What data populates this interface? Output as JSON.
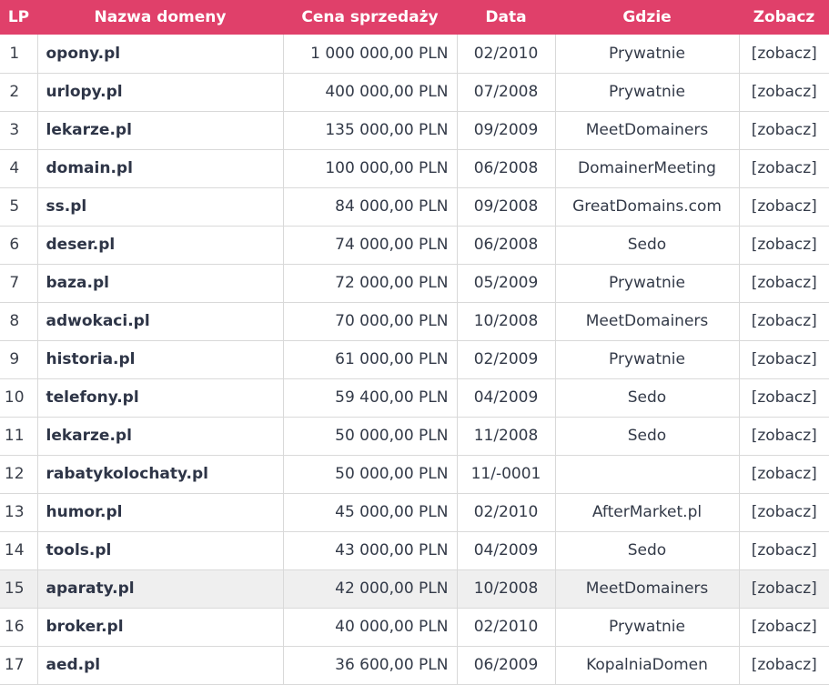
{
  "table": {
    "headers": {
      "lp": "LP",
      "name": "Nazwa domeny",
      "price": "Cena sprzedaży",
      "date": "Data",
      "where": "Gdzie",
      "view": "Zobacz"
    },
    "highlighted_row": 15,
    "rows": [
      {
        "lp": "1",
        "name": "opony.pl",
        "price": "1 000 000,00 PLN",
        "date": "02/2010",
        "where": "Prywatnie",
        "view": "[zobacz]"
      },
      {
        "lp": "2",
        "name": "urlopy.pl",
        "price": "400 000,00 PLN",
        "date": "07/2008",
        "where": "Prywatnie",
        "view": "[zobacz]"
      },
      {
        "lp": "3",
        "name": "lekarze.pl",
        "price": "135 000,00 PLN",
        "date": "09/2009",
        "where": "MeetDomainers",
        "view": "[zobacz]"
      },
      {
        "lp": "4",
        "name": "domain.pl",
        "price": "100 000,00 PLN",
        "date": "06/2008",
        "where": "DomainerMeeting",
        "view": "[zobacz]"
      },
      {
        "lp": "5",
        "name": "ss.pl",
        "price": "84 000,00 PLN",
        "date": "09/2008",
        "where": "GreatDomains.com",
        "view": "[zobacz]"
      },
      {
        "lp": "6",
        "name": "deser.pl",
        "price": "74 000,00 PLN",
        "date": "06/2008",
        "where": "Sedo",
        "view": "[zobacz]"
      },
      {
        "lp": "7",
        "name": "baza.pl",
        "price": "72 000,00 PLN",
        "date": "05/2009",
        "where": "Prywatnie",
        "view": "[zobacz]"
      },
      {
        "lp": "8",
        "name": "adwokaci.pl",
        "price": "70 000,00 PLN",
        "date": "10/2008",
        "where": "MeetDomainers",
        "view": "[zobacz]"
      },
      {
        "lp": "9",
        "name": "historia.pl",
        "price": "61 000,00 PLN",
        "date": "02/2009",
        "where": "Prywatnie",
        "view": "[zobacz]"
      },
      {
        "lp": "10",
        "name": "telefony.pl",
        "price": "59 400,00 PLN",
        "date": "04/2009",
        "where": "Sedo",
        "view": "[zobacz]"
      },
      {
        "lp": "11",
        "name": "lekarze.pl",
        "price": "50 000,00 PLN",
        "date": "11/2008",
        "where": "Sedo",
        "view": "[zobacz]"
      },
      {
        "lp": "12",
        "name": "rabatykolochaty.pl",
        "price": "50 000,00 PLN",
        "date": "11/-0001",
        "where": "",
        "view": "[zobacz]"
      },
      {
        "lp": "13",
        "name": "humor.pl",
        "price": "45 000,00 PLN",
        "date": "02/2010",
        "where": "AfterMarket.pl",
        "view": "[zobacz]"
      },
      {
        "lp": "14",
        "name": "tools.pl",
        "price": "43 000,00 PLN",
        "date": "04/2009",
        "where": "Sedo",
        "view": "[zobacz]"
      },
      {
        "lp": "15",
        "name": "aparaty.pl",
        "price": "42 000,00 PLN",
        "date": "10/2008",
        "where": "MeetDomainers",
        "view": "[zobacz]"
      },
      {
        "lp": "16",
        "name": "broker.pl",
        "price": "40 000,00 PLN",
        "date": "02/2010",
        "where": "Prywatnie",
        "view": "[zobacz]"
      },
      {
        "lp": "17",
        "name": "aed.pl",
        "price": "36 600,00 PLN",
        "date": "06/2009",
        "where": "KopalniaDomen",
        "view": "[zobacz]"
      }
    ]
  },
  "colors": {
    "header_bg": "#e0406a",
    "header_text": "#ffffff",
    "row_highlight": "#efefef",
    "grid_line": "#d9d9d9"
  }
}
